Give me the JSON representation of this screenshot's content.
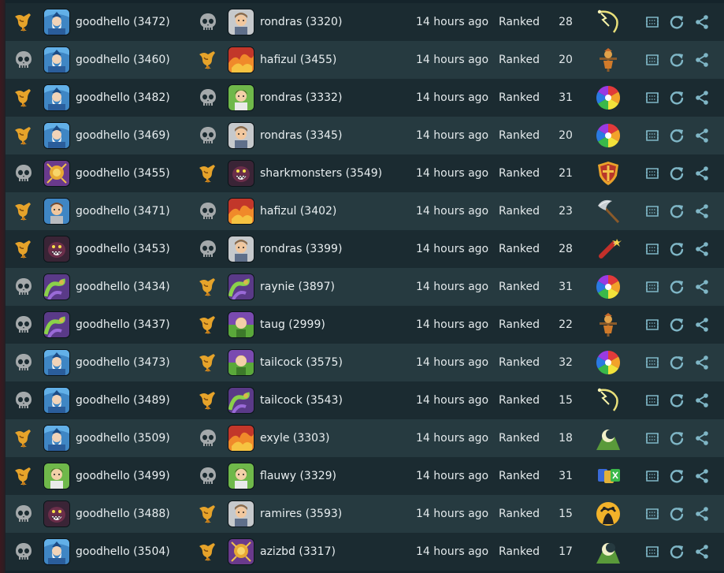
{
  "colors": {
    "row_dark": "#1b2b31",
    "row_light": "#263a40",
    "text": "#e8eef0",
    "action_icon": "#7fb6c6",
    "trophy": "#e6a32a",
    "skull": "#9aa0a3"
  },
  "games": [
    {
      "p1": {
        "result": "win",
        "avatar": "wizard-blue-avatar",
        "name": "goodhello (3472)"
      },
      "p2": {
        "result": "loss",
        "avatar": "warrior-gray-avatar",
        "name": "rondras (3320)"
      },
      "time": "14 hours ago",
      "mode": "Ranked",
      "turns": "28",
      "type_icon": "lightning-whip-icon"
    },
    {
      "p1": {
        "result": "loss",
        "avatar": "wizard-blue-avatar",
        "name": "goodhello (3460)"
      },
      "p2": {
        "result": "win",
        "avatar": "fire-red-avatar",
        "name": "hafizul (3455)"
      },
      "time": "14 hours ago",
      "mode": "Ranked",
      "turns": "20",
      "type_icon": "scarecrow-icon"
    },
    {
      "p1": {
        "result": "win",
        "avatar": "wizard-blue-avatar",
        "name": "goodhello (3482)"
      },
      "p2": {
        "result": "loss",
        "avatar": "druid-green-avatar",
        "name": "rondras (3332)"
      },
      "time": "14 hours ago",
      "mode": "Ranked",
      "turns": "31",
      "type_icon": "color-wheel-icon"
    },
    {
      "p1": {
        "result": "win",
        "avatar": "wizard-blue-avatar",
        "name": "goodhello (3469)"
      },
      "p2": {
        "result": "loss",
        "avatar": "warrior-gray-avatar",
        "name": "rondras (3345)"
      },
      "time": "14 hours ago",
      "mode": "Ranked",
      "turns": "20",
      "type_icon": "color-wheel-icon"
    },
    {
      "p1": {
        "result": "loss",
        "avatar": "golden-purple-avatar",
        "name": "goodhello (3455)"
      },
      "p2": {
        "result": "win",
        "avatar": "monster-dark-avatar",
        "name": "sharkmonsters (3549)"
      },
      "time": "14 hours ago",
      "mode": "Ranked",
      "turns": "21",
      "type_icon": "shield-icon"
    },
    {
      "p1": {
        "result": "win",
        "avatar": "warrior-blue-avatar",
        "name": "goodhello (3471)"
      },
      "p2": {
        "result": "loss",
        "avatar": "fire-red-avatar",
        "name": "hafizul (3402)"
      },
      "time": "14 hours ago",
      "mode": "Ranked",
      "turns": "23",
      "type_icon": "axe-icon"
    },
    {
      "p1": {
        "result": "win",
        "avatar": "monster-dark-avatar",
        "name": "goodhello (3453)"
      },
      "p2": {
        "result": "loss",
        "avatar": "warrior-gray-avatar",
        "name": "rondras (3399)"
      },
      "time": "14 hours ago",
      "mode": "Ranked",
      "turns": "28",
      "type_icon": "dynamite-icon"
    },
    {
      "p1": {
        "result": "loss",
        "avatar": "tentacle-purple-avatar",
        "name": "goodhello (3434)"
      },
      "p2": {
        "result": "win",
        "avatar": "tentacle-purple-avatar",
        "name": "raynie (3897)"
      },
      "time": "14 hours ago",
      "mode": "Ranked",
      "turns": "31",
      "type_icon": "color-wheel-icon"
    },
    {
      "p1": {
        "result": "loss",
        "avatar": "tentacle-purple-avatar",
        "name": "goodhello (3437)"
      },
      "p2": {
        "result": "win",
        "avatar": "elf-green-avatar",
        "name": "taug (2999)"
      },
      "time": "14 hours ago",
      "mode": "Ranked",
      "turns": "22",
      "type_icon": "scarecrow-icon"
    },
    {
      "p1": {
        "result": "loss",
        "avatar": "wizard-blue-avatar",
        "name": "goodhello (3473)"
      },
      "p2": {
        "result": "win",
        "avatar": "elf-green-avatar",
        "name": "tailcock (3575)"
      },
      "time": "14 hours ago",
      "mode": "Ranked",
      "turns": "32",
      "type_icon": "color-wheel-icon"
    },
    {
      "p1": {
        "result": "loss",
        "avatar": "wizard-blue-avatar",
        "name": "goodhello (3489)"
      },
      "p2": {
        "result": "win",
        "avatar": "tentacle-purple-avatar",
        "name": "tailcock (3543)"
      },
      "time": "14 hours ago",
      "mode": "Ranked",
      "turns": "15",
      "type_icon": "lightning-whip-icon"
    },
    {
      "p1": {
        "result": "win",
        "avatar": "wizard-blue-avatar",
        "name": "goodhello (3509)"
      },
      "p2": {
        "result": "loss",
        "avatar": "fire-red-avatar",
        "name": "exyle (3303)"
      },
      "time": "14 hours ago",
      "mode": "Ranked",
      "turns": "18",
      "type_icon": "moon-hill-icon"
    },
    {
      "p1": {
        "result": "win",
        "avatar": "druid-green-avatar",
        "name": "goodhello (3499)"
      },
      "p2": {
        "result": "loss",
        "avatar": "druid-green-avatar",
        "name": "flauwy (3329)"
      },
      "time": "14 hours ago",
      "mode": "Ranked",
      "turns": "31",
      "type_icon": "cards-icon"
    },
    {
      "p1": {
        "result": "loss",
        "avatar": "monster-dark-avatar",
        "name": "goodhello (3488)"
      },
      "p2": {
        "result": "win",
        "avatar": "warrior-gray-avatar",
        "name": "ramires (3593)"
      },
      "time": "14 hours ago",
      "mode": "Ranked",
      "turns": "15",
      "type_icon": "night-tree-icon"
    },
    {
      "p1": {
        "result": "loss",
        "avatar": "wizard-blue-avatar",
        "name": "goodhello (3504)"
      },
      "p2": {
        "result": "win",
        "avatar": "golden-purple-avatar",
        "name": "azizbd (3317)"
      },
      "time": "14 hours ago",
      "mode": "Ranked",
      "turns": "17",
      "type_icon": "moon-hill-icon"
    }
  ],
  "actions": {
    "watch": "watch-icon",
    "replay": "replay-icon",
    "share": "share-icon"
  }
}
